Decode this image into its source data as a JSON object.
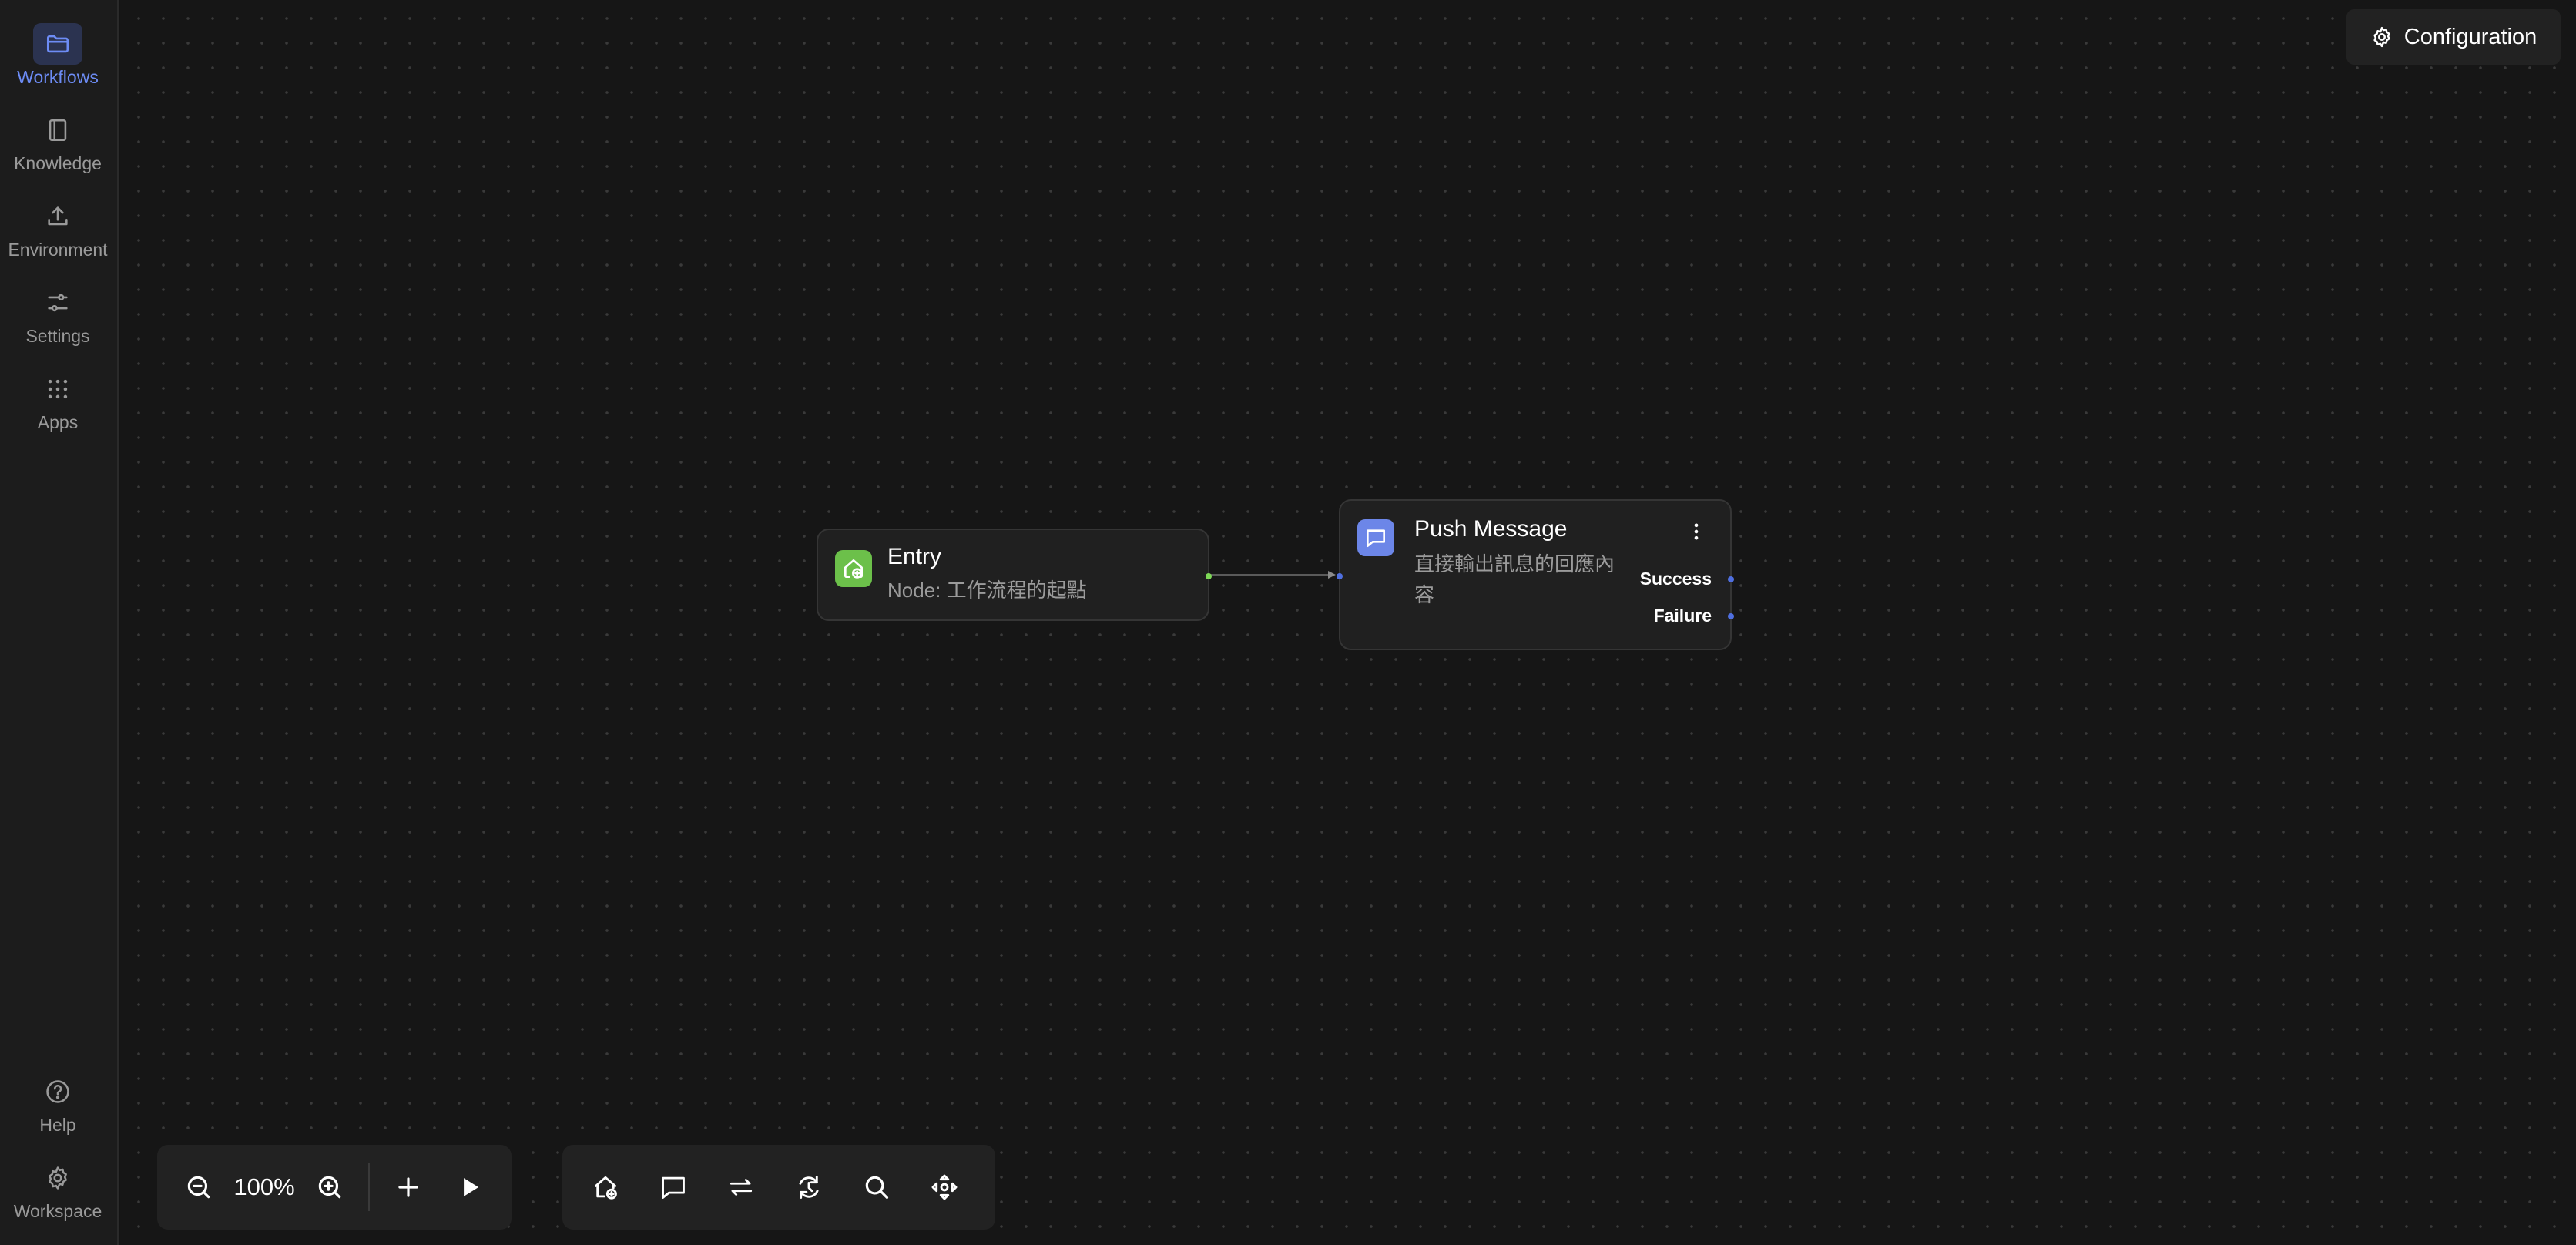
{
  "sidebar": {
    "top_items": [
      {
        "label": "Workflows",
        "icon": "folder-icon",
        "active": true
      },
      {
        "label": "Knowledge",
        "icon": "book-icon",
        "active": false
      },
      {
        "label": "Environment",
        "icon": "upload-icon",
        "active": false
      },
      {
        "label": "Settings",
        "icon": "sliders-icon",
        "active": false
      },
      {
        "label": "Apps",
        "icon": "grid-icon",
        "active": false
      }
    ],
    "bottom_items": [
      {
        "label": "Help",
        "icon": "help-circle-icon"
      },
      {
        "label": "Workspace",
        "icon": "gear-icon"
      }
    ]
  },
  "header": {
    "config_label": "Configuration"
  },
  "nodes": {
    "entry": {
      "title": "Entry",
      "description": "Node: 工作流程的起點",
      "icon": "home-plus-icon",
      "icon_color": "#6cc04a"
    },
    "push_message": {
      "title": "Push Message",
      "description": "直接輸出訊息的回應內容",
      "icon": "message-square-icon",
      "icon_color": "#6c86e8",
      "ports": [
        "Success",
        "Failure"
      ]
    }
  },
  "toolbar": {
    "zoom_level": "100%"
  },
  "colors": {
    "accent": "#6d8cf5",
    "entry_handle": "#7ed957",
    "message_handle": "#4f6fe0",
    "canvas_bg": "#161616"
  }
}
